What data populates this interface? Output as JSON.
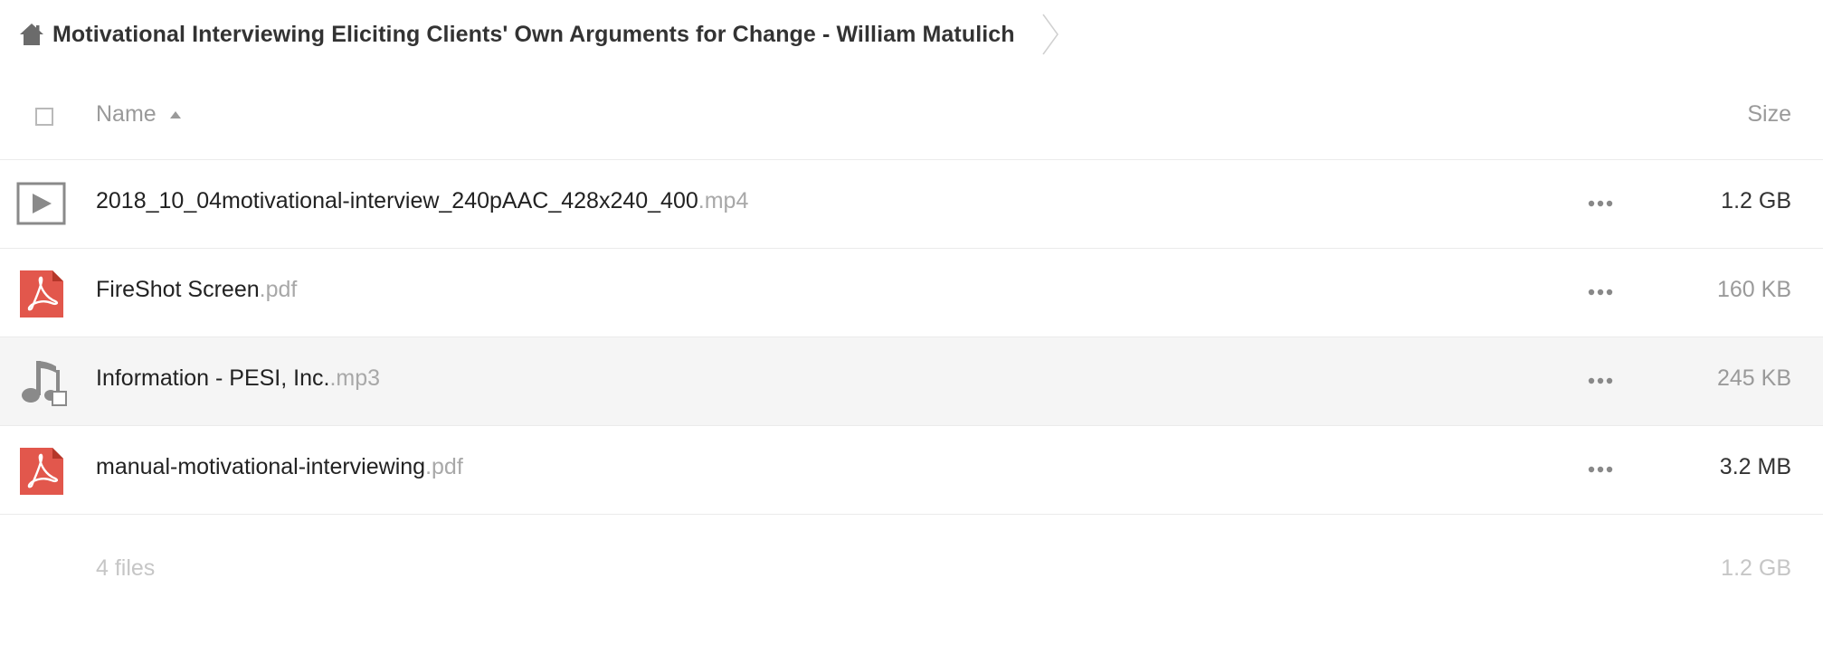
{
  "breadcrumb": {
    "home_icon": "home-icon",
    "folder_name": "Motivational Interviewing Eliciting Clients' Own Arguments for Change - William Matulich"
  },
  "table_header": {
    "name_label": "Name",
    "size_label": "Size",
    "sort_direction": "ascending"
  },
  "files": [
    {
      "icon": "video-file-icon",
      "base": "2018_10_04motivational-interview_240pAAC_428x240_400",
      "ext": ".mp4",
      "size": "1.2 GB"
    },
    {
      "icon": "pdf-file-icon",
      "base": "FireShot Screen",
      "ext": ".pdf",
      "size": "160 KB"
    },
    {
      "icon": "audio-file-icon",
      "base": "Information - PESI, Inc.",
      "ext": ".mp3",
      "size": "245 KB"
    },
    {
      "icon": "pdf-file-icon",
      "base": "manual-motivational-interviewing",
      "ext": ".pdf",
      "size": "3.2 MB"
    }
  ],
  "footer": {
    "count": "4 files",
    "total": "1.2 GB"
  },
  "colors": {
    "pdf_red": "#e2574c",
    "icon_gray": "#8a8a8a",
    "hover_row": "#f5f5f5"
  }
}
